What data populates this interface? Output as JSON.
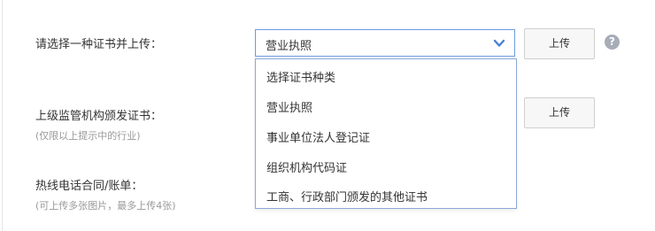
{
  "form": {
    "cert_type_label": "请选择一种证书并上传：",
    "authority_cert_label": "上级监管机构颁发证书：",
    "authority_cert_hint": "(仅限以上提示中的行业)",
    "hotline_label": "热线电话合同/账单：",
    "hotline_hint": "(可上传多张图片，最多上传4张)"
  },
  "cert_select": {
    "selected": "营业执照",
    "options": [
      "选择证书种类",
      "营业执照",
      "事业单位法人登记证",
      "组织机构代码证",
      "工商、行政部门颁发的其他证书"
    ]
  },
  "buttons": {
    "upload_1": "上传",
    "upload_2": "上传"
  },
  "help": {
    "glyph": "?"
  },
  "colors": {
    "accent": "#4a7fd6",
    "select_border": "#6e9bdc",
    "hint_text": "#999999",
    "help_icon_bg": "#a7acb8"
  }
}
